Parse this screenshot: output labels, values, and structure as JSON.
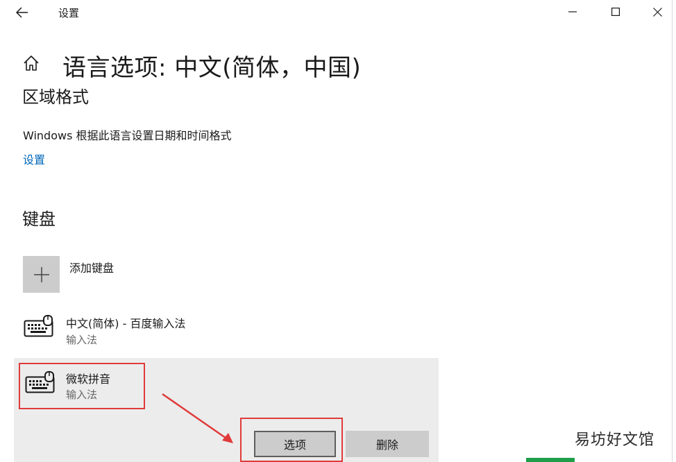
{
  "window": {
    "title": "设置",
    "back_icon": "arrow-left-icon",
    "controls": [
      "minimize-icon",
      "maximize-icon",
      "close-icon"
    ]
  },
  "page": {
    "title": "语言选项: 中文(简体，中国)",
    "home_icon": "home-icon"
  },
  "region": {
    "heading": "区域格式",
    "description": "Windows 根据此语言设置日期和时间格式",
    "settings_link": "设置"
  },
  "keyboard": {
    "heading": "键盘",
    "add_label": "添加键盘",
    "items": [
      {
        "name": "中文(简体) - 百度输入法",
        "type": "输入法",
        "icon": "keyboard-icon"
      },
      {
        "name": "微软拼音",
        "type": "输入法",
        "icon": "keyboard-icon",
        "selected": true
      }
    ],
    "options_button": "选项",
    "remove_button": "删除"
  },
  "watermark": "易坊好文馆",
  "colors": {
    "link": "#0067b8",
    "annotation": "#e03a3a",
    "tile": "#cccccc",
    "selected_bg": "#ececec"
  }
}
